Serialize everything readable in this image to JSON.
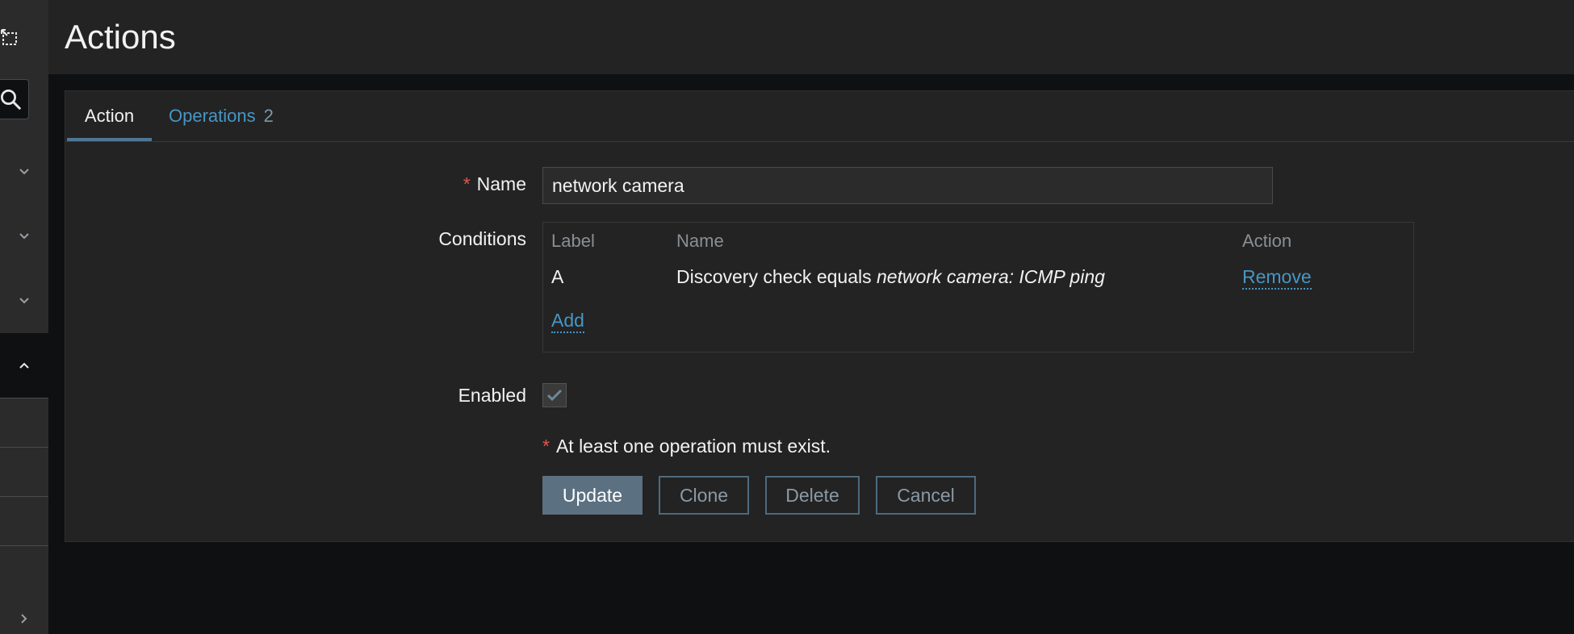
{
  "sidebar": {
    "collapse_icon": "collapse-icon",
    "search_icon": "search-icon",
    "expand_icon": "chevron-right-icon"
  },
  "header": {
    "title": "Actions"
  },
  "tabs": [
    {
      "label": "Action",
      "active": true
    },
    {
      "label": "Operations",
      "count": "2",
      "active": false
    }
  ],
  "form": {
    "name_label": "Name",
    "required_mark": "*",
    "name_value": "network camera",
    "conditions_label": "Conditions",
    "conditions_table": {
      "headers": [
        "Label",
        "Name",
        "Action"
      ],
      "rows": [
        {
          "label": "A",
          "name_prefix": "Discovery check equals",
          "name_value": "network camera: ICMP ping",
          "action": "Remove"
        }
      ],
      "add_label": "Add"
    },
    "enabled_label": "Enabled",
    "enabled": true,
    "note": "At least one operation must exist."
  },
  "buttons": {
    "update": "Update",
    "clone": "Clone",
    "delete": "Delete",
    "cancel": "Cancel"
  },
  "colors": {
    "accent": "#4796c4",
    "required": "#e2564f",
    "primary_button": "#5b7182"
  }
}
